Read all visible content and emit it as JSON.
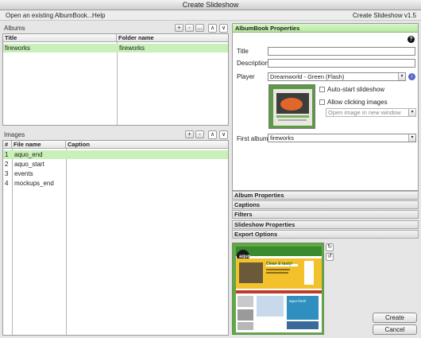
{
  "window": {
    "title": "Create Slideshow"
  },
  "menu": {
    "open_label": "Open an existing AlbumBook...",
    "help_label": "Help",
    "version": "Create Slideshow v1.5"
  },
  "albums": {
    "label": "Albums",
    "add": "+",
    "remove": "-",
    "more": "...",
    "up": "∧",
    "down": "∨",
    "columns": [
      "Title",
      "Folder name"
    ],
    "rows": [
      {
        "title": "fireworks",
        "folder": "fireworks"
      }
    ]
  },
  "images": {
    "label": "Images",
    "add": "+",
    "remove": "-",
    "up": "∧",
    "down": "∨",
    "columns": [
      "#",
      "File name",
      "Caption"
    ],
    "rows": [
      {
        "num": "1",
        "file": "aquo_end",
        "caption": ""
      },
      {
        "num": "2",
        "file": "aquo_start",
        "caption": ""
      },
      {
        "num": "3",
        "file": "events",
        "caption": ""
      },
      {
        "num": "4",
        "file": "mockups_end",
        "caption": ""
      }
    ]
  },
  "props": {
    "header": "AlbumBook Properties",
    "help": "?",
    "title_label": "Title",
    "title_value": "",
    "description_label": "Description",
    "description_value": "",
    "player_label": "Player",
    "player_value": "Dreamworld - Green (Flash)",
    "info": "i",
    "autostart_label": "Auto-start slideshow",
    "allow_click_label": "Allow clicking images",
    "click_action_value": "Open image in new window",
    "first_album_label": "First album",
    "first_album_value": "fireworks",
    "dropdown_arrow": "▾"
  },
  "accordions": [
    "Album Properties",
    "Captions",
    "Filters",
    "Slideshow Properties",
    "Export Options"
  ],
  "preview": {
    "rotate_cw": "↻",
    "rotate_ccw": "↺",
    "logo_text": "aquo",
    "headline": "Clean & tasty!",
    "sub_headline": "aquo fresh"
  },
  "buttons": {
    "create": "Create",
    "cancel": "Cancel"
  }
}
